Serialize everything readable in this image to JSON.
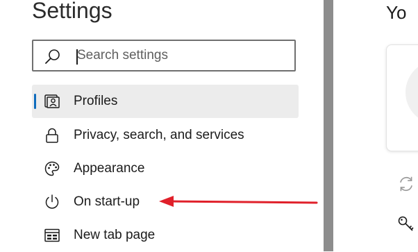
{
  "sidebar": {
    "title": "Settings",
    "search": {
      "placeholder": "Search settings",
      "value": ""
    },
    "items": [
      {
        "label": "Profiles",
        "icon": "profile-icon",
        "active": true
      },
      {
        "label": "Privacy, search, and services",
        "icon": "lock-icon",
        "active": false
      },
      {
        "label": "Appearance",
        "icon": "palette-icon",
        "active": false
      },
      {
        "label": "On start-up",
        "icon": "power-icon",
        "active": false
      },
      {
        "label": "New tab page",
        "icon": "new-tab-icon",
        "active": false
      }
    ]
  },
  "main": {
    "title": "Yo"
  },
  "annotation": {
    "arrow_color": "#e0202a",
    "points_to": "On start-up"
  },
  "colors": {
    "accent": "#0f6cbd",
    "active_bg": "#ececec",
    "divider": "#8d8d8d"
  }
}
